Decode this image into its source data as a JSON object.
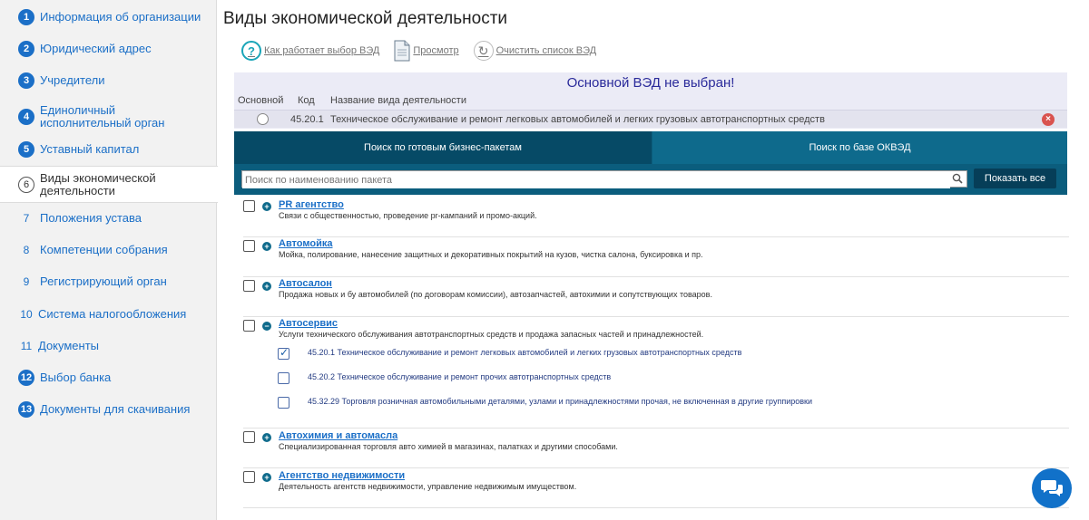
{
  "sidebar": {
    "items": [
      {
        "num": "1",
        "label": "Информация об организации"
      },
      {
        "num": "2",
        "label": "Юридический адрес"
      },
      {
        "num": "3",
        "label": "Учредители"
      },
      {
        "num": "4",
        "label": "Единоличный исполнительный орган"
      },
      {
        "num": "5",
        "label": "Уставный капитал"
      },
      {
        "num": "6",
        "label": "Виды экономической деятельности"
      },
      {
        "num": "7",
        "label": "Положения устава"
      },
      {
        "num": "8",
        "label": "Компетенции собрания"
      },
      {
        "num": "9",
        "label": "Регистрирующий орган"
      },
      {
        "num": "10",
        "label": "Система налогообложения"
      },
      {
        "num": "11",
        "label": "Документы"
      },
      {
        "num": "12",
        "label": "Выбор банка"
      },
      {
        "num": "13",
        "label": "Документы для скачивания"
      }
    ]
  },
  "page": {
    "title": "Виды экономической деятельности"
  },
  "toolbar": {
    "help": "Как работает выбор ВЭД",
    "preview": "Просмотр",
    "clear": "Очистить список ВЭД"
  },
  "ved": {
    "warning": "Основной ВЭД не выбран!",
    "headers": {
      "main": "Основной",
      "code": "Код",
      "name": "Название вида деятельности"
    },
    "row": {
      "code": "45.20.1",
      "name": "Техническое обслуживание и ремонт легковых автомобилей и легких грузовых автотранспортных средств"
    }
  },
  "tabs": [
    {
      "label": "Поиск по готовым бизнес-пакетам"
    },
    {
      "label": "Поиск по базе ОКВЭД"
    }
  ],
  "search": {
    "placeholder": "Поиск по наименованию пакета",
    "value": "",
    "button": "Показать все"
  },
  "packages": [
    {
      "name": "PR агентство",
      "desc": "Связи с общественностью, проведение pr-кампаний и промо-акций.",
      "expanded": false
    },
    {
      "name": "Автомойка",
      "desc": "Мойка, полирование, нанесение защитных и декоративных покрытий на кузов, чистка салона, буксировка и пр.",
      "expanded": false
    },
    {
      "name": "Автосалон",
      "desc": "Продажа новых и бу автомобилей (по договорам комиссии), автозапчастей, автохимии и сопутствующих товаров.",
      "expanded": false
    },
    {
      "name": "Автосервис",
      "desc": "Услуги технического обслуживания автотранспортных средств и продажа запасных частей и принадлежностей.",
      "expanded": true,
      "items": [
        {
          "text": "45.20.1 Техническое обслуживание и ремонт легковых автомобилей и легких грузовых автотранспортных средств",
          "checked": true
        },
        {
          "text": "45.20.2 Техническое обслуживание и ремонт прочих автотранспортных средств",
          "checked": false
        },
        {
          "text": "45.32.29 Торговля розничная автомобильными деталями, узлами и принадлежностями прочая, не включенная в другие группировки",
          "checked": false
        }
      ]
    },
    {
      "name": "Автохимия и автомасла",
      "desc": "Специализированная торговля авто химией в магазинах, палатках и другими способами.",
      "expanded": false
    },
    {
      "name": "Агентство недвижимости",
      "desc": "Деятельность агентств недвижимости, управление недвижимым имуществом.",
      "expanded": false
    }
  ],
  "colors": {
    "accent": "#1b6fc7",
    "tab_bg": "#0b5d7d",
    "warning": "#2a2a9a",
    "delete": "#d9534f",
    "chat": "#1171c9"
  },
  "icons": {
    "help": "question-circle-icon",
    "preview": "document-icon",
    "clear": "refresh-icon",
    "search": "magnifier-icon",
    "delete": "close-circle-icon",
    "chat": "chat-bubbles-icon"
  }
}
